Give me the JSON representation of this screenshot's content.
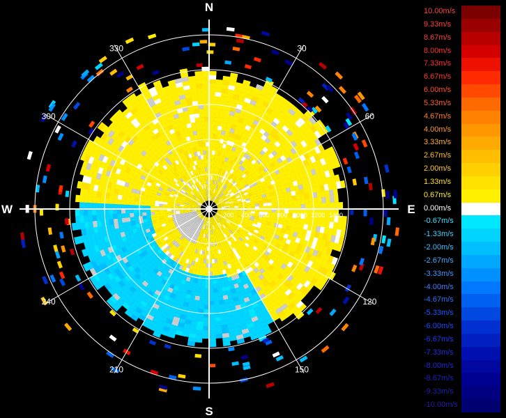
{
  "chart_data": {
    "type": "heatmap",
    "subtype": "polar radar PPI (radial velocity)",
    "compass_labels": [
      "N",
      "E",
      "S",
      "W"
    ],
    "azimuth_labels": [
      "30",
      "60",
      "120",
      "150",
      "210",
      "240",
      "300",
      "330"
    ],
    "range_ticks": [
      "200",
      "400",
      "600",
      "800",
      "1000",
      "1200",
      "1400"
    ],
    "range_max": 1400,
    "background": "#000000",
    "grid": true,
    "legend_position": "right",
    "colorbar": [
      {
        "label": "10.00m/s",
        "color": "#7a0000",
        "text_color": "#ff4040"
      },
      {
        "label": "9.33m/s",
        "color": "#990000",
        "text_color": "#ff4040"
      },
      {
        "label": "8.67m/s",
        "color": "#b80000",
        "text_color": "#ff4040"
      },
      {
        "label": "8.00m/s",
        "color": "#d40000",
        "text_color": "#ff3030"
      },
      {
        "label": "7.33m/s",
        "color": "#ee1100",
        "text_color": "#ff3030"
      },
      {
        "label": "6.67m/s",
        "color": "#ff2a00",
        "text_color": "#ff3a20"
      },
      {
        "label": "6.00m/s",
        "color": "#ff4a00",
        "text_color": "#ff5020"
      },
      {
        "label": "5.33m/s",
        "color": "#ff6a00",
        "text_color": "#ff6020"
      },
      {
        "label": "4.67m/s",
        "color": "#ff8200",
        "text_color": "#ff8020"
      },
      {
        "label": "4.00m/s",
        "color": "#ff9800",
        "text_color": "#ff9a20"
      },
      {
        "label": "3.33m/s",
        "color": "#ffaa00",
        "text_color": "#ffb020"
      },
      {
        "label": "2.67m/s",
        "color": "#ffbe00",
        "text_color": "#ffc020"
      },
      {
        "label": "2.00m/s",
        "color": "#ffd000",
        "text_color": "#ffd020"
      },
      {
        "label": "1.33m/s",
        "color": "#ffe200",
        "text_color": "#ffe020"
      },
      {
        "label": "0.67m/s",
        "color": "#fff000",
        "text_color": "#fff020"
      },
      {
        "label": "0.00m/s",
        "color": "#ffffff",
        "text_color": "#ffffff"
      },
      {
        "label": "-0.67m/s",
        "color": "#00e8ff",
        "text_color": "#40e0ff"
      },
      {
        "label": "-1.33m/s",
        "color": "#00d4ff",
        "text_color": "#40d0ff"
      },
      {
        "label": "-2.00m/s",
        "color": "#00bfff",
        "text_color": "#40c0ff"
      },
      {
        "label": "-2.67m/s",
        "color": "#00a8ff",
        "text_color": "#40b0ff"
      },
      {
        "label": "-3.33m/s",
        "color": "#0090ff",
        "text_color": "#4098ff"
      },
      {
        "label": "-4.00m/s",
        "color": "#0078ff",
        "text_color": "#4080ff"
      },
      {
        "label": "-4.67m/s",
        "color": "#0060f0",
        "text_color": "#3070ff"
      },
      {
        "label": "-5.33m/s",
        "color": "#0048e0",
        "text_color": "#2058ff"
      },
      {
        "label": "-6.00m/s",
        "color": "#0030d0",
        "text_color": "#2048ff"
      },
      {
        "label": "-6.67m/s",
        "color": "#0020c0",
        "text_color": "#2038f0"
      },
      {
        "label": "-7.33m/s",
        "color": "#0010b0",
        "text_color": "#2030e0"
      },
      {
        "label": "-8.00m/s",
        "color": "#0008a0",
        "text_color": "#2028d0"
      },
      {
        "label": "-8.67m/s",
        "color": "#000090",
        "text_color": "#2020c0"
      },
      {
        "label": "-9.33m/s",
        "color": "#000080",
        "text_color": "#2020b0"
      },
      {
        "label": "-10.00m/s",
        "color": "#000070",
        "text_color": "#2020a0"
      }
    ],
    "field_summary": {
      "dominant_inner_velocity_mps": 0.67,
      "southwest_sector_velocity_mps": -1.33,
      "echo_extent_approx": 1000
    }
  }
}
